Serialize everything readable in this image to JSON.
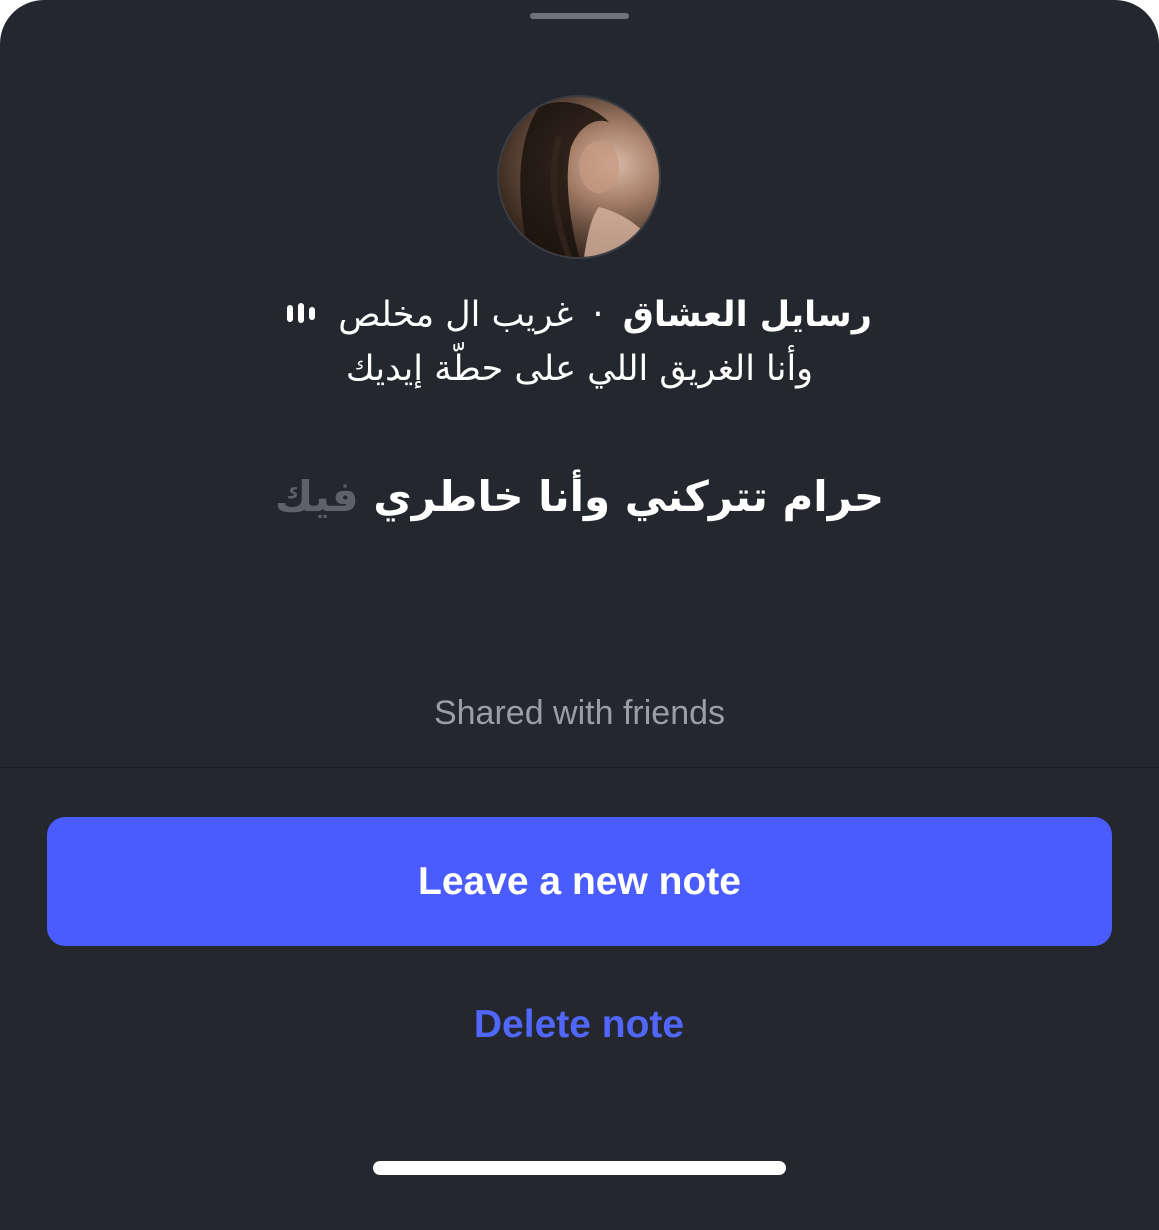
{
  "profile": {
    "avatar_icon": "profile-photo",
    "name": "رسايل العشاق",
    "separator": "·",
    "song": "غريب ال مخلص",
    "music_icon": "music-bars-icon",
    "lyric_line": "وأنا الغريق اللي على حطّة إيديك"
  },
  "note": {
    "text_main": "حرام تتركني وأنا خاطري",
    "text_faded": "فيك",
    "audience": "Shared with friends"
  },
  "actions": {
    "leave_new_note": "Leave a new note",
    "delete_note": "Delete note"
  },
  "colors": {
    "sheet_background": "#24272d",
    "primary_button": "#4a5cfe",
    "delete_text": "#5166fb",
    "secondary_text": "#9b9ea5",
    "faded_text": "#5e6168"
  }
}
